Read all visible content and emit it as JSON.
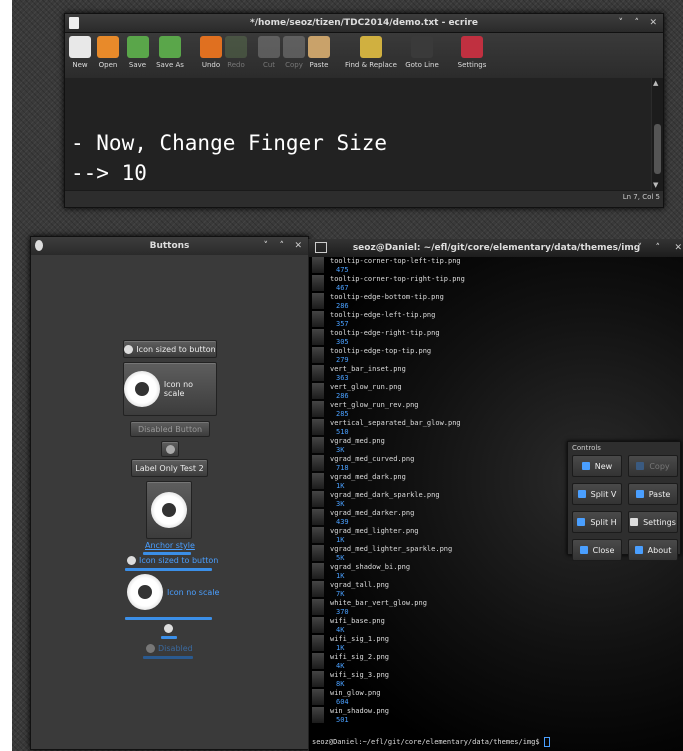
{
  "ecrire": {
    "title": "*/home/seoz/tizen/TDC2014/demo.txt - ecrire",
    "controls": [
      "˅",
      "˄",
      "✕"
    ],
    "toolbar": [
      {
        "label": "New",
        "color": "#e8e8e8",
        "enabled": true
      },
      {
        "label": "Open",
        "color": "#e88a2a",
        "enabled": true
      },
      {
        "label": "Save",
        "color": "#5aa64a",
        "enabled": true
      },
      {
        "label": "Save As",
        "color": "#5aa64a",
        "enabled": true
      },
      {
        "label": "Undo",
        "color": "#e07020",
        "enabled": true
      },
      {
        "label": "Redo",
        "color": "#6a8a5a",
        "enabled": false
      },
      {
        "label": "Cut",
        "color": "#aaaaaa",
        "enabled": false
      },
      {
        "label": "Copy",
        "color": "#aaaaaa",
        "enabled": false
      },
      {
        "label": "Paste",
        "color": "#c9a26a",
        "enabled": true
      },
      {
        "label": "Find & Replace",
        "color": "#d0b040",
        "enabled": true
      },
      {
        "label": "Goto Line",
        "color": "#3a3a3a",
        "enabled": true
      },
      {
        "label": "Settings",
        "color": "#c03040",
        "enabled": true
      }
    ],
    "text_line1": "- Now, Change Finger Size",
    "text_line2": "--> 10",
    "status": "Ln 7, Col 5"
  },
  "buttons": {
    "title": "Buttons",
    "controls": [
      "˅",
      "˄",
      "✕"
    ],
    "icon_sized": "Icon sized to button",
    "icon_no_scale": "Icon no scale",
    "disabled_button": "Disabled Button",
    "label_only": "Label Only Test 2",
    "anchor_style": "Anchor style",
    "anchor_icon_sized": "Icon sized to button",
    "anchor_icon_no_scale": "Icon no scale",
    "anchor_disabled": "Disabled"
  },
  "terminal": {
    "title": "seoz@Daniel: ~/efl/git/core/elementary/data/themes/img",
    "controls": [
      "˅",
      "˄",
      "✕"
    ],
    "files": [
      {
        "name": "tooltip-corner-top-left-tip.png",
        "size": "475"
      },
      {
        "name": "tooltip-corner-top-right-tip.png",
        "size": "467"
      },
      {
        "name": "tooltip-edge-bottom-tip.png",
        "size": "286"
      },
      {
        "name": "tooltip-edge-left-tip.png",
        "size": "357"
      },
      {
        "name": "tooltip-edge-right-tip.png",
        "size": "305"
      },
      {
        "name": "tooltip-edge-top-tip.png",
        "size": "279"
      },
      {
        "name": "vert_bar_inset.png",
        "size": "363"
      },
      {
        "name": "vert_glow_run.png",
        "size": "286"
      },
      {
        "name": "vert_glow_run_rev.png",
        "size": "285"
      },
      {
        "name": "vertical_separated_bar_glow.png",
        "size": "510"
      },
      {
        "name": "vgrad_med.png",
        "size": "3K"
      },
      {
        "name": "vgrad_med_curved.png",
        "size": "718"
      },
      {
        "name": "vgrad_med_dark.png",
        "size": "1K"
      },
      {
        "name": "vgrad_med_dark_sparkle.png",
        "size": "3K"
      },
      {
        "name": "vgrad_med_darker.png",
        "size": "439"
      },
      {
        "name": "vgrad_med_lighter.png",
        "size": "1K"
      },
      {
        "name": "vgrad_med_lighter_sparkle.png",
        "size": "5K"
      },
      {
        "name": "vgrad_shadow_bi.png",
        "size": "1K"
      },
      {
        "name": "vgrad_tall.png",
        "size": "7K"
      },
      {
        "name": "white_bar_vert_glow.png",
        "size": "370"
      },
      {
        "name": "wifi_base.png",
        "size": "4K"
      },
      {
        "name": "wifi_sig_1.png",
        "size": "1K"
      },
      {
        "name": "wifi_sig_2.png",
        "size": "4K"
      },
      {
        "name": "wifi_sig_3.png",
        "size": "8K"
      },
      {
        "name": "win_glow.png",
        "size": "604"
      },
      {
        "name": "win_shadow.png",
        "size": "501"
      }
    ],
    "prompt": "seoz@Daniel:~/efl/git/core/elementary/data/themes/img$ "
  },
  "controls_panel": {
    "title": "Controls",
    "buttons": [
      {
        "label": "New",
        "color": "#4a9fff",
        "enabled": true
      },
      {
        "label": "Copy",
        "color": "#4a9fff",
        "enabled": false
      },
      {
        "label": "Split V",
        "color": "#4a9fff",
        "enabled": true
      },
      {
        "label": "Paste",
        "color": "#4a9fff",
        "enabled": true
      },
      {
        "label": "Split H",
        "color": "#4a9fff",
        "enabled": true
      },
      {
        "label": "Settings",
        "color": "#dddddd",
        "enabled": true
      },
      {
        "label": "Close",
        "color": "#4a9fff",
        "enabled": true
      },
      {
        "label": "About",
        "color": "#4a9fff",
        "enabled": true
      }
    ]
  }
}
